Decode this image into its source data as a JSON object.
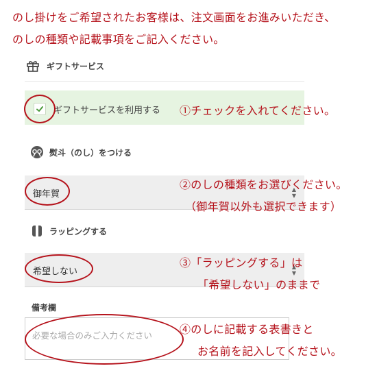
{
  "intro": {
    "line1": "のし掛けをご希望されたお客様は、注文画面をお進みいただき、",
    "line2": "のしの種類や記載事項をご記入ください。"
  },
  "gift_section": {
    "icon": "gift-icon",
    "title": "ギフトサービス",
    "checkbox_label": "ギフトサービスを利用する",
    "checked": true
  },
  "noshi_section": {
    "icon": "noshi-icon",
    "title": "熨斗（のし）をつける",
    "selected": "御年賀"
  },
  "wrap_section": {
    "icon": "wrapping-icon",
    "title": "ラッピングする",
    "selected": "希望しない"
  },
  "remarks_section": {
    "title": "備考欄",
    "placeholder": "必要な場合のみご入力ください"
  },
  "annotations": {
    "note1": "①チェックを入れてください。",
    "note2_line1": "②のしの種類をお選びください。",
    "note2_line2": "（御年賀以外も選択できます）",
    "note3_line1": "③「ラッピングする」は",
    "note3_line2": "「希望しない」のままで",
    "note4_line1": "④のしに記載する表書きと",
    "note4_line2": "お名前を記入してください。"
  },
  "colors": {
    "annotation_red": "#b5121b",
    "gift_row_bg": "#e6f4e1",
    "check_green": "#4a9a3a",
    "select_bg": "#eeeeee"
  }
}
